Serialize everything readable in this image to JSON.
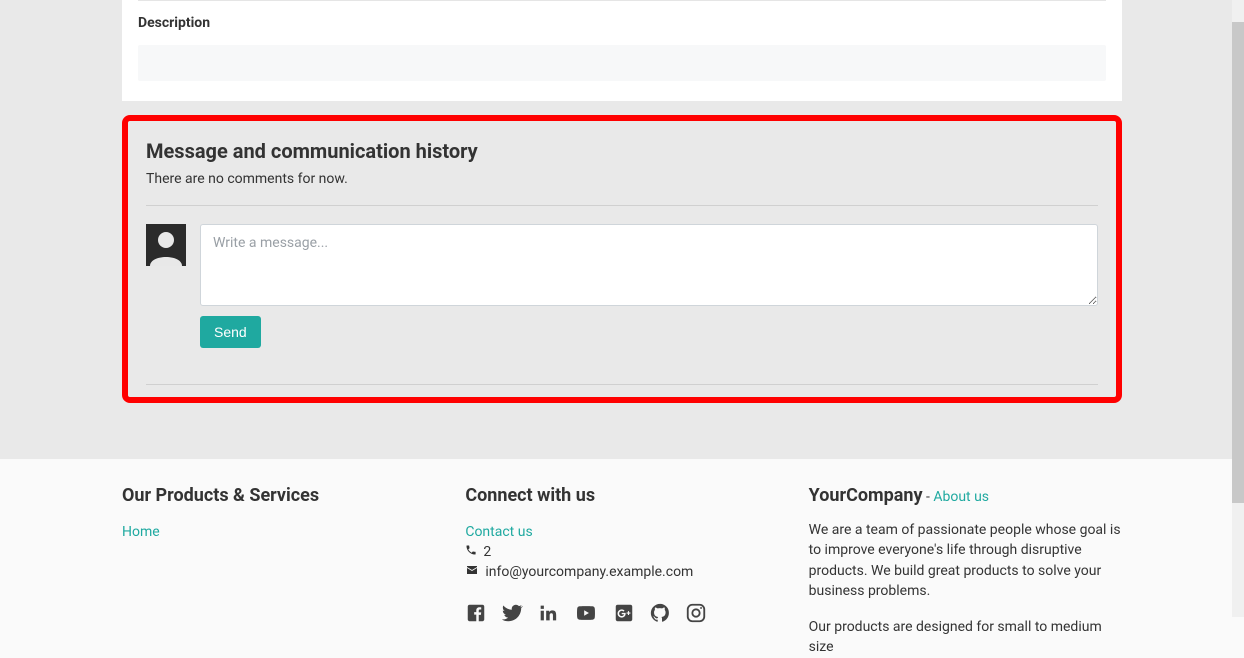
{
  "top": {
    "description_label": "Description"
  },
  "message_section": {
    "title": "Message and communication history",
    "empty_text": "There are no comments for now.",
    "textarea_placeholder": "Write a message...",
    "send_label": "Send"
  },
  "footer": {
    "col1": {
      "heading": "Our Products & Services",
      "home_link": "Home"
    },
    "col2": {
      "heading": "Connect with us",
      "contact_link": "Contact us",
      "phone": "2",
      "email": "info@yourcompany.example.com"
    },
    "col3": {
      "company_name": "YourCompany",
      "about_sep": " - ",
      "about_link": "About us",
      "para1": "We are a team of passionate people whose goal is to improve everyone's life through disruptive products. We build great products to solve your business problems.",
      "para2": "Our products are designed for small to medium size"
    }
  }
}
